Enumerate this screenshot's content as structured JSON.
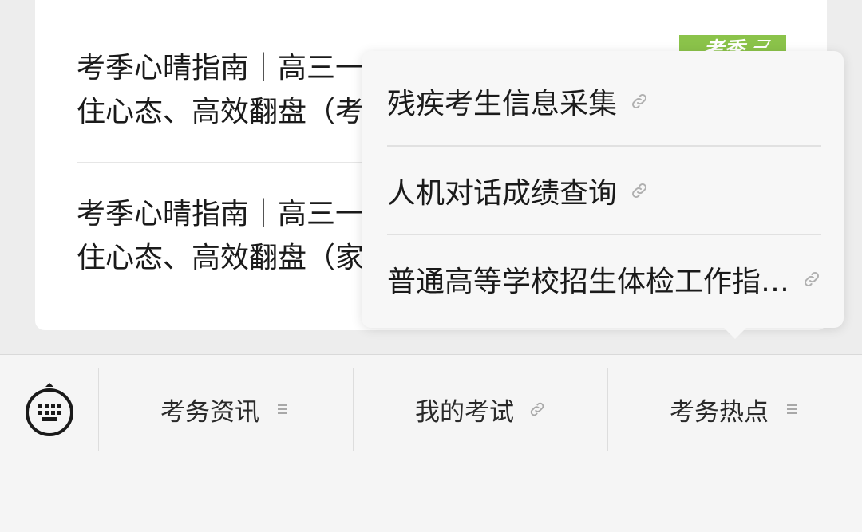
{
  "articles": [
    {
      "line1": "考季心晴指南｜高三一",
      "line2": "住心态、高效翻盘（考"
    },
    {
      "line1": "考季心晴指南｜高三一",
      "line2": "住心态、高效翻盘（家"
    }
  ],
  "thumbnail": {
    "text": "考季"
  },
  "popup": {
    "items": [
      {
        "label": "残疾考生信息采集",
        "icon": "link-icon"
      },
      {
        "label": "人机对话成绩查询",
        "icon": "link-icon"
      },
      {
        "label": "普通高等学校招生体检工作指…",
        "icon": "link-icon"
      }
    ]
  },
  "bottom_menu": {
    "keyboard_icon": "keyboard-icon",
    "tabs": [
      {
        "label": "考务资讯",
        "icon": "menu-lines-icon"
      },
      {
        "label": "我的考试",
        "icon": "link-icon"
      },
      {
        "label": "考务热点",
        "icon": "menu-lines-icon"
      }
    ]
  },
  "colors": {
    "card_bg": "#ffffff",
    "page_bg": "#ededed",
    "thumbnail_green": "#8bc34a",
    "text": "#1a1a1a",
    "icon_gray": "#b0b0b0"
  }
}
